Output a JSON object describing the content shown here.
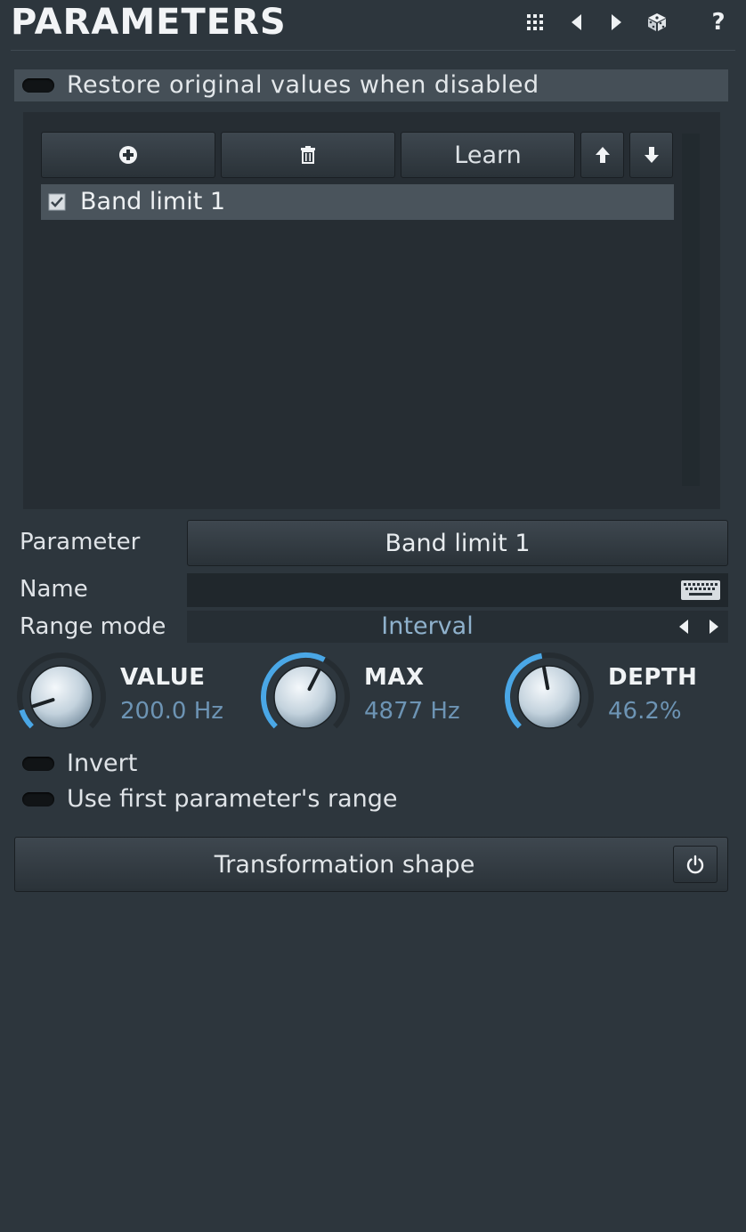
{
  "header": {
    "title": "PARAMETERS",
    "icons": [
      "grid-icon",
      "arrow-left-icon",
      "arrow-right-icon",
      "dice-icon",
      "help-icon"
    ],
    "help_label": "?"
  },
  "restore": {
    "label": "Restore original values when disabled",
    "enabled": false
  },
  "list_toolbar": {
    "learn_label": "Learn"
  },
  "list": {
    "items": [
      {
        "label": "Band limit 1",
        "checked": true
      }
    ]
  },
  "parameter": {
    "label": "Parameter",
    "value": "Band limit 1"
  },
  "name": {
    "label": "Name",
    "value": ""
  },
  "range_mode": {
    "label": "Range mode",
    "value": "Interval"
  },
  "knobs": [
    {
      "title": "VALUE",
      "value": "200.0 Hz",
      "level": 0.1
    },
    {
      "title": "MAX",
      "value": "4877 Hz",
      "level": 0.6
    },
    {
      "title": "DEPTH",
      "value": "46.2%",
      "level": 0.462
    }
  ],
  "toggles": {
    "invert": {
      "label": "Invert",
      "enabled": false
    },
    "first_range": {
      "label": "Use first parameter's range",
      "enabled": false
    }
  },
  "transformation": {
    "label": "Transformation shape"
  },
  "colors": {
    "background": "#2d363d",
    "accent": "#4aa7e6",
    "value_text": "#6d94b4"
  }
}
